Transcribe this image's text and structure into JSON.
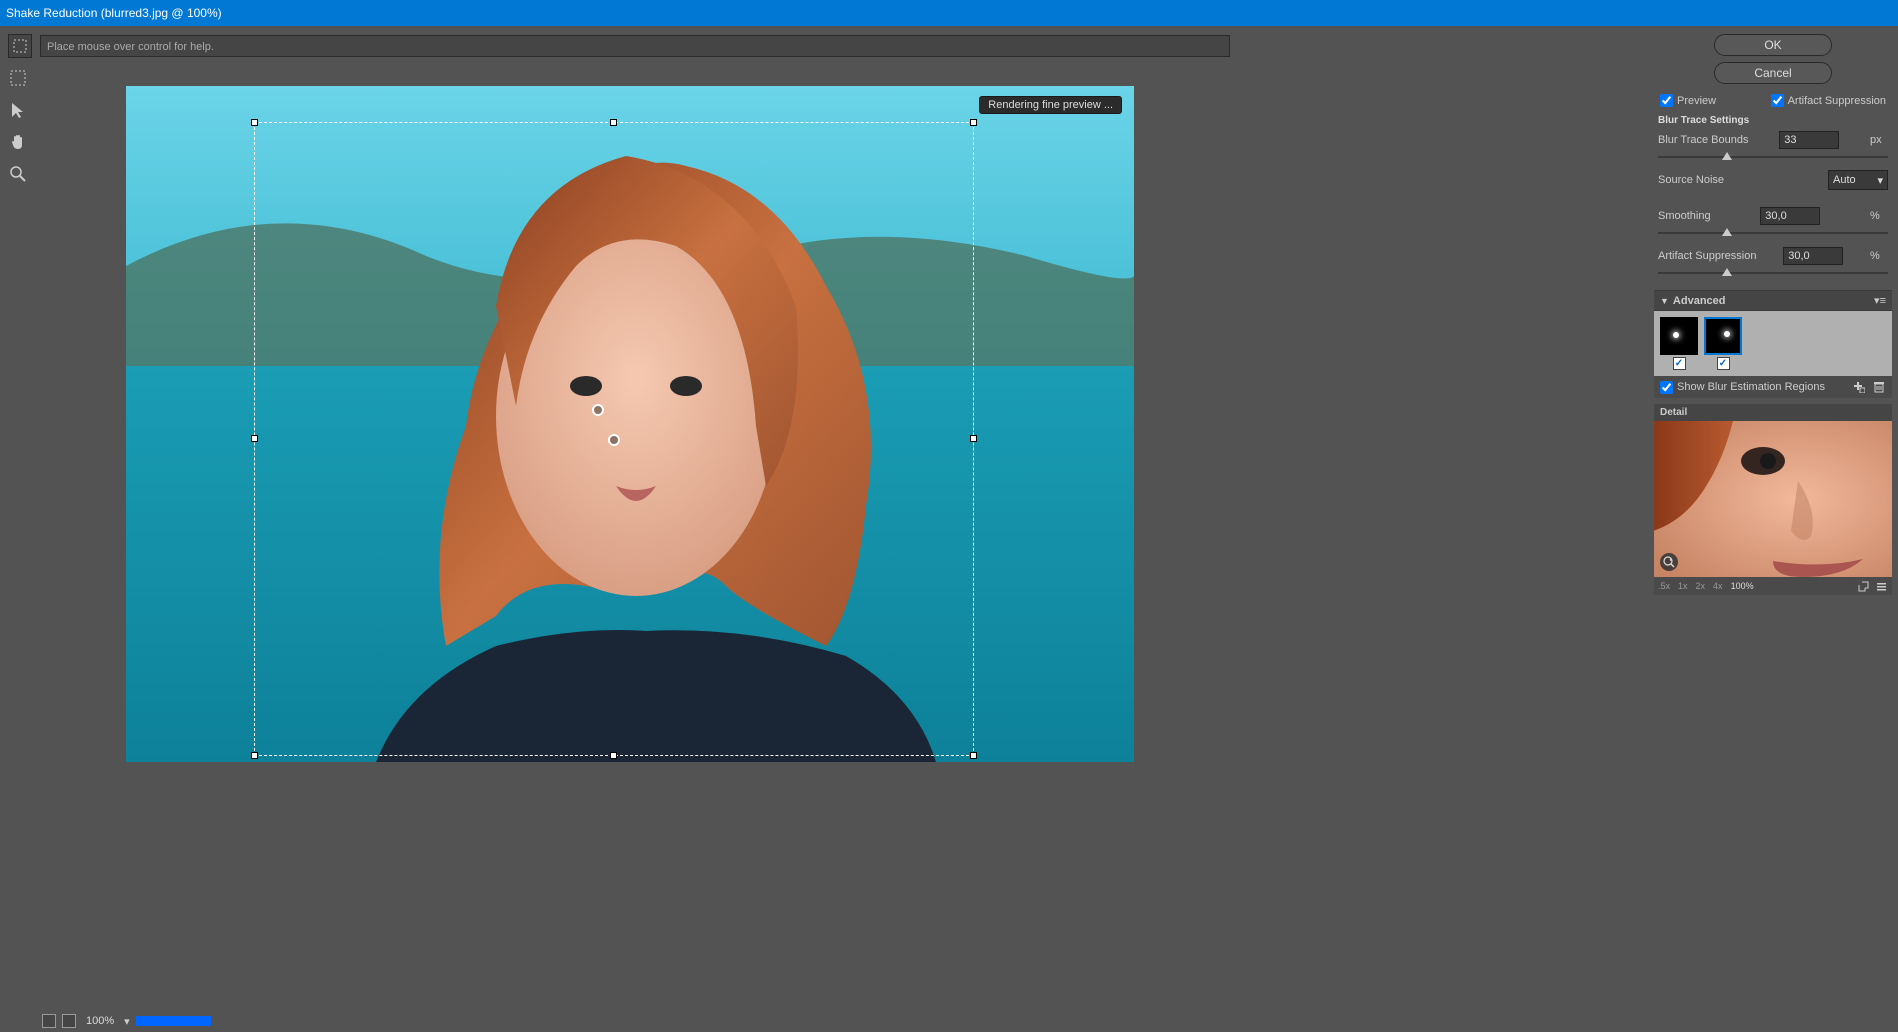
{
  "title": "Shake Reduction (blurred3.jpg @ 100%)",
  "helpText": "Place mouse over control for help.",
  "renderingBadge": "Rendering fine preview ...",
  "buttons": {
    "ok": "OK",
    "cancel": "Cancel"
  },
  "checks": {
    "preview": "Preview",
    "artifactSuppression": "Artifact Suppression",
    "showBlurRegions": "Show Blur Estimation Regions"
  },
  "settings": {
    "heading": "Blur Trace Settings",
    "blurTraceBounds": {
      "label": "Blur Trace Bounds",
      "value": "33",
      "unit": "px",
      "pos": 30
    },
    "sourceNoise": {
      "label": "Source Noise",
      "value": "Auto"
    },
    "smoothing": {
      "label": "Smoothing",
      "value": "30,0",
      "unit": "%",
      "pos": 30
    },
    "artifactSuppression": {
      "label": "Artifact Suppression",
      "value": "30,0",
      "unit": "%",
      "pos": 30
    }
  },
  "advanced": {
    "label": "Advanced"
  },
  "detail": {
    "heading": "Detail",
    "zoomLevels": [
      ".5x",
      "1x",
      "2x",
      "4x",
      "100%"
    ],
    "activeZoom": "100%"
  },
  "zoomDisplay": "100%"
}
